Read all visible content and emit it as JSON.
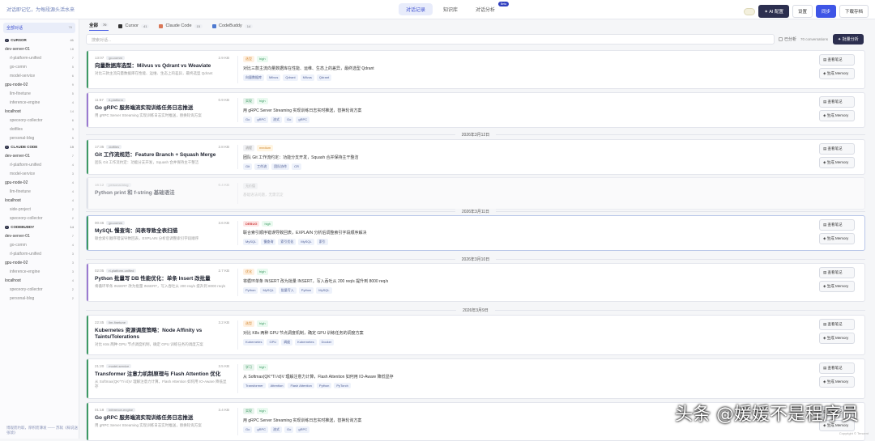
{
  "header": {
    "tagline": "对话即记忆，为每段源头活水来",
    "tabs": [
      "对话记录",
      "知识库",
      "对话分析"
    ],
    "beta": "Beta",
    "buttons": {
      "ai": "AI 配置",
      "settings": "设置",
      "sync": "同步",
      "download": "下载存档"
    }
  },
  "sidebar": {
    "all": {
      "label": "全部对话",
      "count": "76"
    },
    "sections": [
      {
        "name": "CURSOR",
        "count": "41",
        "hosts": [
          {
            "host": "dev-server-01",
            "count": "18",
            "projects": [
              {
                "n": "rl-platform-unified",
                "c": "7"
              },
              {
                "n": "go-comm",
                "c": "5"
              },
              {
                "n": "model-service",
                "c": "6"
              }
            ]
          },
          {
            "host": "gpu-node-02",
            "count": "9",
            "projects": [
              {
                "n": "llm-finetune",
                "c": "5"
              },
              {
                "n": "inference-engine",
                "c": "4"
              }
            ]
          },
          {
            "host": "localhost",
            "count": "14",
            "projects": [
              {
                "n": "speceory-collector",
                "c": "6"
              },
              {
                "n": "dotfiles",
                "c": "3"
              },
              {
                "n": "personal-blog",
                "c": "5"
              }
            ]
          }
        ]
      },
      {
        "name": "CLAUDE CODE",
        "count": "15",
        "hosts": [
          {
            "host": "dev-server-01",
            "count": "7",
            "projects": [
              {
                "n": "rl-platform-unified",
                "c": "4"
              },
              {
                "n": "model-service",
                "c": "3"
              }
            ]
          },
          {
            "host": "gpu-node-02",
            "count": "4",
            "projects": [
              {
                "n": "llm-finetune",
                "c": "4"
              }
            ]
          },
          {
            "host": "localhost",
            "count": "4",
            "projects": [
              {
                "n": "side-project",
                "c": "2"
              },
              {
                "n": "speceory-collector",
                "c": "2"
              }
            ]
          }
        ]
      },
      {
        "name": "CODEBUDDY",
        "count": "14",
        "hosts": [
          {
            "host": "dev-server-01",
            "count": "7",
            "projects": [
              {
                "n": "go-comm",
                "c": "4"
              },
              {
                "n": "rl-platform-unified",
                "c": "3"
              }
            ]
          },
          {
            "host": "gpu-node-02",
            "count": "3",
            "projects": [
              {
                "n": "inference-engine",
                "c": "3"
              }
            ]
          },
          {
            "host": "localhost",
            "count": "4",
            "projects": [
              {
                "n": "speceory-collector",
                "c": "2"
              },
              {
                "n": "personal-blog",
                "c": "2"
              }
            ]
          }
        ]
      }
    ],
    "footer": "博观而约取，厚积而薄发 —— 苏轼《稼说送张琥》"
  },
  "filters": [
    {
      "label": "全部",
      "count": "70",
      "active": true
    },
    {
      "label": "Cursor",
      "count": "41"
    },
    {
      "label": "Claude Code",
      "count": "15"
    },
    {
      "label": "CodeBuddy",
      "count": "14"
    }
  ],
  "search": {
    "placeholder": "搜索对话...",
    "checkbox": "已分析",
    "count": "70 conversations",
    "bulk": "批量分析"
  },
  "actions": {
    "note": "查看笔记",
    "memory": "生成 Memory"
  },
  "dates": [
    "2026年3月12日",
    "2026年3月11日",
    "2026年3月10日",
    "2026年3月9日"
  ],
  "cards": [
    {
      "time": "13:07",
      "proj": "go-comm",
      "size": "2.9 KB",
      "title": "向量数据库选型：Milvus vs Qdrant vs Weaviate",
      "desc": "对比三款主流向量数据库在性能、运维、生态上的差异，最终选型 Qdrant",
      "cat": "选型",
      "pri": "high",
      "summary": "对比三款主流向量数据库在性能、运维、生态上的差异，最终选型 Qdrant",
      "kws": [
        "向量数据库",
        "Milvus",
        "Qdrant",
        "Milvus",
        "Qdrant"
      ],
      "color": "#3d9a63"
    },
    {
      "time": "11:57",
      "proj": "rl-platform",
      "size": "0.9 KB",
      "title": "Go gRPC 服务端流实现训练任务日志推送",
      "desc": "用 gRPC Server Streaming 实现训练日志实时推送，替换轮询方案",
      "cat": "实现",
      "pri": "high",
      "summary": "用 gRPC Server Streaming 实现训练日志实时推送，替换轮询方案",
      "kws": [
        "Go",
        "gRPC",
        "流式",
        "Go",
        "gRPC"
      ],
      "color": "#9b7ad0"
    },
    {
      "time": "17:35",
      "proj": "dotfiles",
      "size": "2.8 KB",
      "title": "Git 工作流规范：Feature Branch + Squash Merge",
      "desc": "团队 Git 工作流约定：功能分支开发，Squash 合并保持主干整洁",
      "cat": "流程",
      "pri": "medium",
      "summary": "团队 Git 工作流约定：功能分支开发，Squash 合并保持主干整洁",
      "kws": [
        "Git",
        "工作流",
        "团队协作",
        "CR"
      ],
      "color": "#3d9a63"
    },
    {
      "time": "16:12",
      "proj": "personal-blog",
      "size": "0.4 KB",
      "title": "Python print 和 f-string 基础语法",
      "desc": "",
      "cat": "无价值",
      "pri": "",
      "summary": "基础语法问题，无需沉淀",
      "kws": [],
      "color": "#cfd4e0",
      "dim": true
    },
    {
      "time": "00:46",
      "proj": "go-comm",
      "size": "3.6 KB",
      "title": "MySQL 慢查询：间表导致全表扫描",
      "desc": "联合索引顺序错误导致回表，EXPLAIN 分析后调整索引字段顺序",
      "cat": "DEBUG",
      "pri": "high",
      "summary": "联合索引顺序错误导致回表，EXPLAIN 分析后调整索引字段顺序解决",
      "kws": [
        "MySQL",
        "慢查询",
        "索引优化",
        "MySQL",
        "索引"
      ],
      "color": "#3d9a63",
      "hl": true
    },
    {
      "time": "02:05",
      "proj": "rl-platform-unified",
      "size": "2.7 KB",
      "title": "Python 批量写 DB 性能优化：单条 Insert 改批量",
      "desc": "将循环单条 INSERT 改为批量 INSERT，写入吞吐从 200 req/s 提升到 8000 req/s",
      "cat": "优化",
      "pri": "high",
      "summary": "将循环单条 INSERT 改为批量 INSERT，写入吞吐从 200 req/s 提升到 8000 req/s",
      "kws": [
        "Python",
        "MySQL",
        "批量写入",
        "Python",
        "MySQL"
      ],
      "color": "#9b7ad0"
    },
    {
      "time": "22:45",
      "proj": "llm-finetune",
      "size": "3.2 KB",
      "title": "Kubernetes 资源调度策略：Node Affinity vs Taints/Tolerations",
      "desc": "对比 K8s 两种 GPU 节点调度机制，确定 GPU 训练任务的调度方案",
      "cat": "选型",
      "pri": "high",
      "summary": "对比 K8s 两种 GPU 节点调度机制，确定 GPU 训练任务的调度方案",
      "kws": [
        "Kubernetes",
        "GPU",
        "调度",
        "Kubernetes",
        "Docker"
      ],
      "color": "#3d9a63"
    },
    {
      "time": "21:20",
      "proj": "model-service",
      "size": "3.5 KB",
      "title": "Transformer 注意力机制原理与 Flash Attention 优化",
      "desc": "从 Softmax(QK^T/√d)V 理解注意力计算，Flash Attention 如何用 IO-Aware 降低显存",
      "cat": "学习",
      "pri": "high",
      "summary": "从 Softmax(QK^T/√d)V 理解注意力计算，Flash Attention 如何用 IO-Aware 降低显存",
      "kws": [
        "Transformer",
        "Attention",
        "Flash Attention",
        "Python",
        "PyTorch"
      ],
      "color": "#3d9a63"
    },
    {
      "time": "01:18",
      "proj": "inference-engine",
      "size": "3.4 KB",
      "title": "Go gRPC 服务端流实现训练任务日志推送",
      "desc": "用 gRPC Server Streaming 实现训练日志实时推送，替换轮询方案",
      "cat": "实现",
      "pri": "high",
      "summary": "用 gRPC Server Streaming 实现训练日志实时推送，替换轮询方案",
      "kws": [
        "Go",
        "gRPC",
        "流式",
        "Go",
        "gRPC"
      ],
      "color": "#3d9a63"
    }
  ],
  "watermark": "头条 @媛媛不是程序员",
  "copyright": "Copyright © Tencent"
}
